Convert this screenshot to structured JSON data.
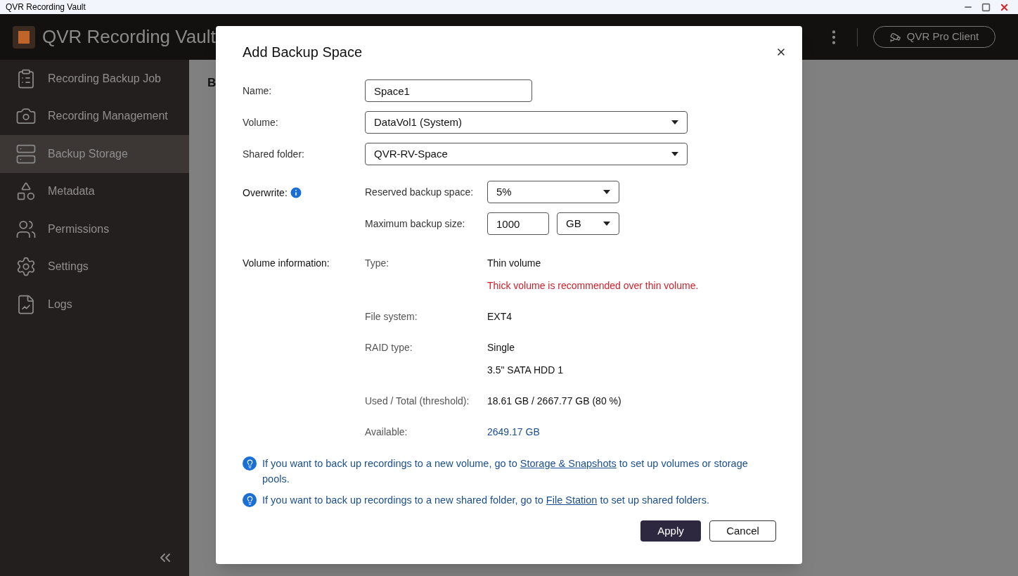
{
  "window": {
    "title": "QVR Recording Vault"
  },
  "app": {
    "name": "QVR Recording Vault",
    "client_button": "QVR Pro Client"
  },
  "sidebar": {
    "items": [
      {
        "label": "Recording Backup Job",
        "selected": false
      },
      {
        "label": "Recording Management",
        "selected": false
      },
      {
        "label": "Backup Storage",
        "selected": true
      },
      {
        "label": "Metadata",
        "selected": false
      },
      {
        "label": "Permissions",
        "selected": false
      },
      {
        "label": "Settings",
        "selected": false
      },
      {
        "label": "Logs",
        "selected": false
      }
    ]
  },
  "main": {
    "heading": "B"
  },
  "dialog": {
    "title": "Add Backup Space",
    "fields": [
      {
        "label": "Name:",
        "kind": "text",
        "value": "Space1"
      },
      {
        "label": "Volume:",
        "kind": "select",
        "value": "DataVol1 (System)"
      },
      {
        "label": "Shared folder:",
        "kind": "select",
        "value": "QVR-RV-Space"
      }
    ],
    "overwrite": {
      "label": "Overwrite:",
      "reserved": {
        "label": "Reserved backup space:",
        "value": "5%"
      },
      "maximum": {
        "label": "Maximum backup size:",
        "value": "1000",
        "unit": "GB"
      }
    },
    "volume_info": {
      "label": "Volume information:",
      "rows": [
        {
          "label": "Type:",
          "values": [
            {
              "text": "Thin volume",
              "kind": "plain"
            },
            {
              "text": "Thick volume is recommended over thin volume.",
              "kind": "warning"
            }
          ]
        },
        {
          "label": "File system:",
          "values": [
            {
              "text": "EXT4",
              "kind": "plain"
            }
          ]
        },
        {
          "label": "RAID type:",
          "values": [
            {
              "text": "Single",
              "kind": "plain"
            },
            {
              "text": "3.5\" SATA HDD 1",
              "kind": "plain"
            }
          ]
        },
        {
          "label": "Used / Total (threshold):",
          "values": [
            {
              "text": "18.61 GB / 2667.77 GB (80 %)",
              "kind": "plain"
            }
          ]
        },
        {
          "label": "Available:",
          "values": [
            {
              "text": "2649.17 GB",
              "kind": "accent"
            }
          ]
        }
      ]
    },
    "tips": [
      {
        "before": "If you want to back up recordings to a new volume, go to ",
        "link": "Storage & Snapshots",
        "after": " to set up volumes or storage pools."
      },
      {
        "before": "If you want to back up recordings to a new shared folder, go to ",
        "link": "File Station",
        "after": " to set up shared folders."
      }
    ],
    "buttons": [
      {
        "label": "Apply",
        "kind": "primary"
      },
      {
        "label": "Cancel",
        "kind": "secondary"
      }
    ]
  }
}
